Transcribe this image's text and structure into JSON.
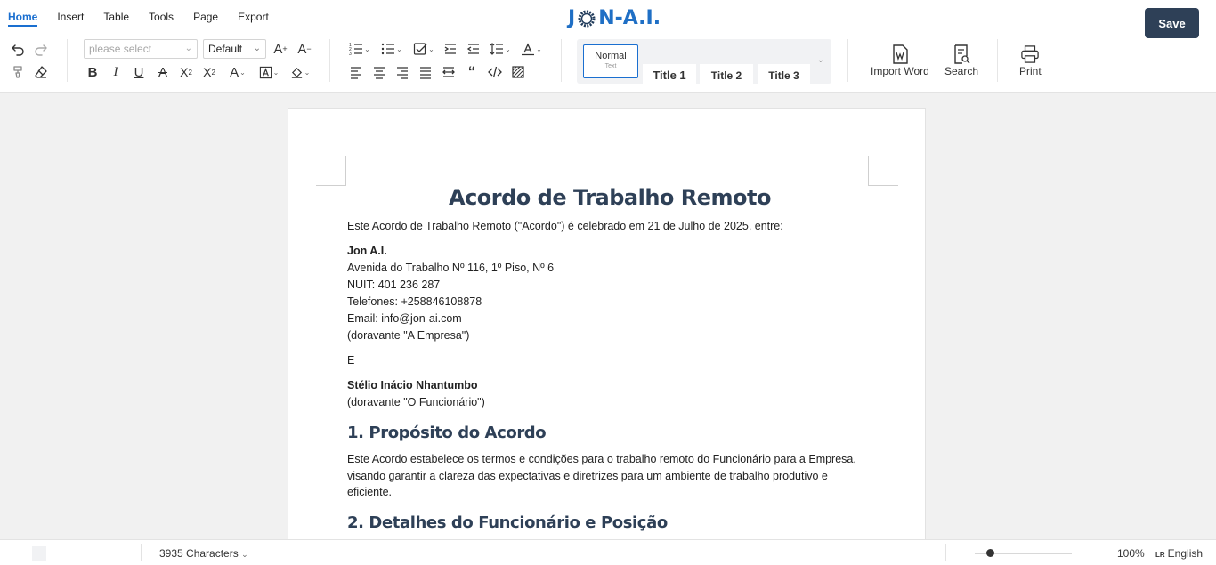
{
  "menu": {
    "items": [
      {
        "label": "Home"
      },
      {
        "label": "Insert"
      },
      {
        "label": "Table"
      },
      {
        "label": "Tools"
      },
      {
        "label": "Page"
      },
      {
        "label": "Export"
      }
    ],
    "active": "Home"
  },
  "logo": {
    "text_left": "J",
    "text_right": "N-A.I."
  },
  "save_label": "Save",
  "toolbar": {
    "font_select_placeholder": "please select",
    "size_select_value": "Default",
    "styles": {
      "normal_label": "Normal",
      "normal_sub": "Text",
      "title1": "Title 1",
      "title2": "Title 2",
      "title3": "Title 3"
    },
    "import_word_label": "Import Word",
    "search_label": "Search",
    "print_label": "Print"
  },
  "document": {
    "title": "Acordo de Trabalho Remoto",
    "intro": "Este Acordo de Trabalho Remoto (\"Acordo\") é celebrado em 21 de Julho de 2025, entre:",
    "company": {
      "name": "Jon A.I.",
      "address": "Avenida do Trabalho Nº 116, 1º Piso, Nº 6",
      "nuit": "NUIT: 401 236 287",
      "phones": "Telefones: +258846108878",
      "email": "Email: info@jon-ai.com",
      "alias": "(doravante \"A Empresa\")"
    },
    "conjunction": "E",
    "employee": {
      "name": "Stélio Inácio Nhantumbo",
      "alias": "(doravante \"O Funcionário\")"
    },
    "section1_heading": "1. Propósito do Acordo",
    "section1_text": "Este Acordo estabelece os termos e condições para o trabalho remoto do Funcionário para a Empresa, visando garantir a clareza das expectativas e diretrizes para um ambiente de trabalho produtivo e eficiente.",
    "section2_heading": "2. Detalhes do Funcionário e Posição"
  },
  "status": {
    "characters": "3935 Characters",
    "zoom": "100%",
    "language_prefix": "LR",
    "language": "English",
    "zoom_level_fraction": 0.12
  },
  "colors": {
    "accent": "#1a6fd0",
    "save_bg": "#2e4057",
    "heading": "#2e4057"
  }
}
